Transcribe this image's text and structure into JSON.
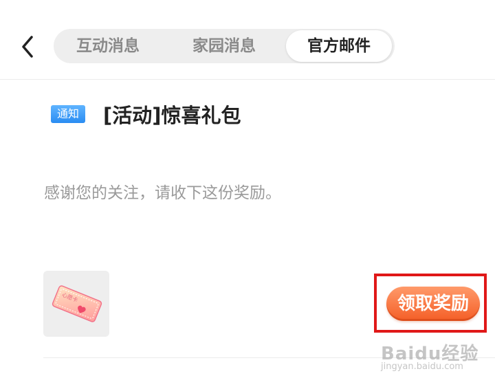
{
  "header": {
    "back_icon": "chevron-left-icon",
    "tabs": [
      {
        "label": "互动消息",
        "active": false
      },
      {
        "label": "家园消息",
        "active": false
      },
      {
        "label": "官方邮件",
        "active": true
      }
    ]
  },
  "message": {
    "badge": "通知",
    "title": "[活动]惊喜礼包",
    "body": "感谢您的关注，请收下这份奖励。"
  },
  "reward": {
    "icon": "heart-ticket-icon",
    "ticket_text": "心愿卡",
    "claim_label": "领取奖励"
  },
  "colors": {
    "badge_blue": "#2a8cf2",
    "claim_orange": "#f45e26",
    "highlight_red": "#e01818"
  },
  "watermark": {
    "main": "Baidu经验",
    "sub": "jingyan.baidu.com"
  }
}
